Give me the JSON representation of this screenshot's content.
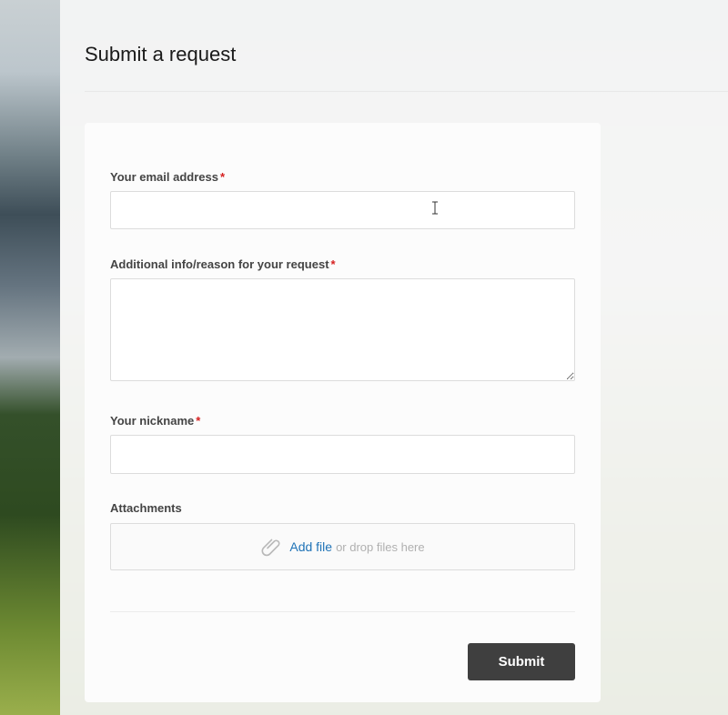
{
  "page": {
    "title": "Submit a request"
  },
  "form": {
    "email": {
      "label": "Your email address",
      "required_mark": "*",
      "value": ""
    },
    "additional_info": {
      "label": "Additional info/reason for your request",
      "required_mark": "*",
      "value": ""
    },
    "nickname": {
      "label": "Your nickname",
      "required_mark": "*",
      "value": ""
    },
    "attachments": {
      "label": "Attachments",
      "add_file": "Add file",
      "drop_hint": "or drop files here",
      "icon": "paperclip-icon"
    },
    "submit_label": "Submit"
  },
  "colors": {
    "required": "#d62020",
    "link": "#1f73b7",
    "submit_bg": "#3f3f3f"
  }
}
